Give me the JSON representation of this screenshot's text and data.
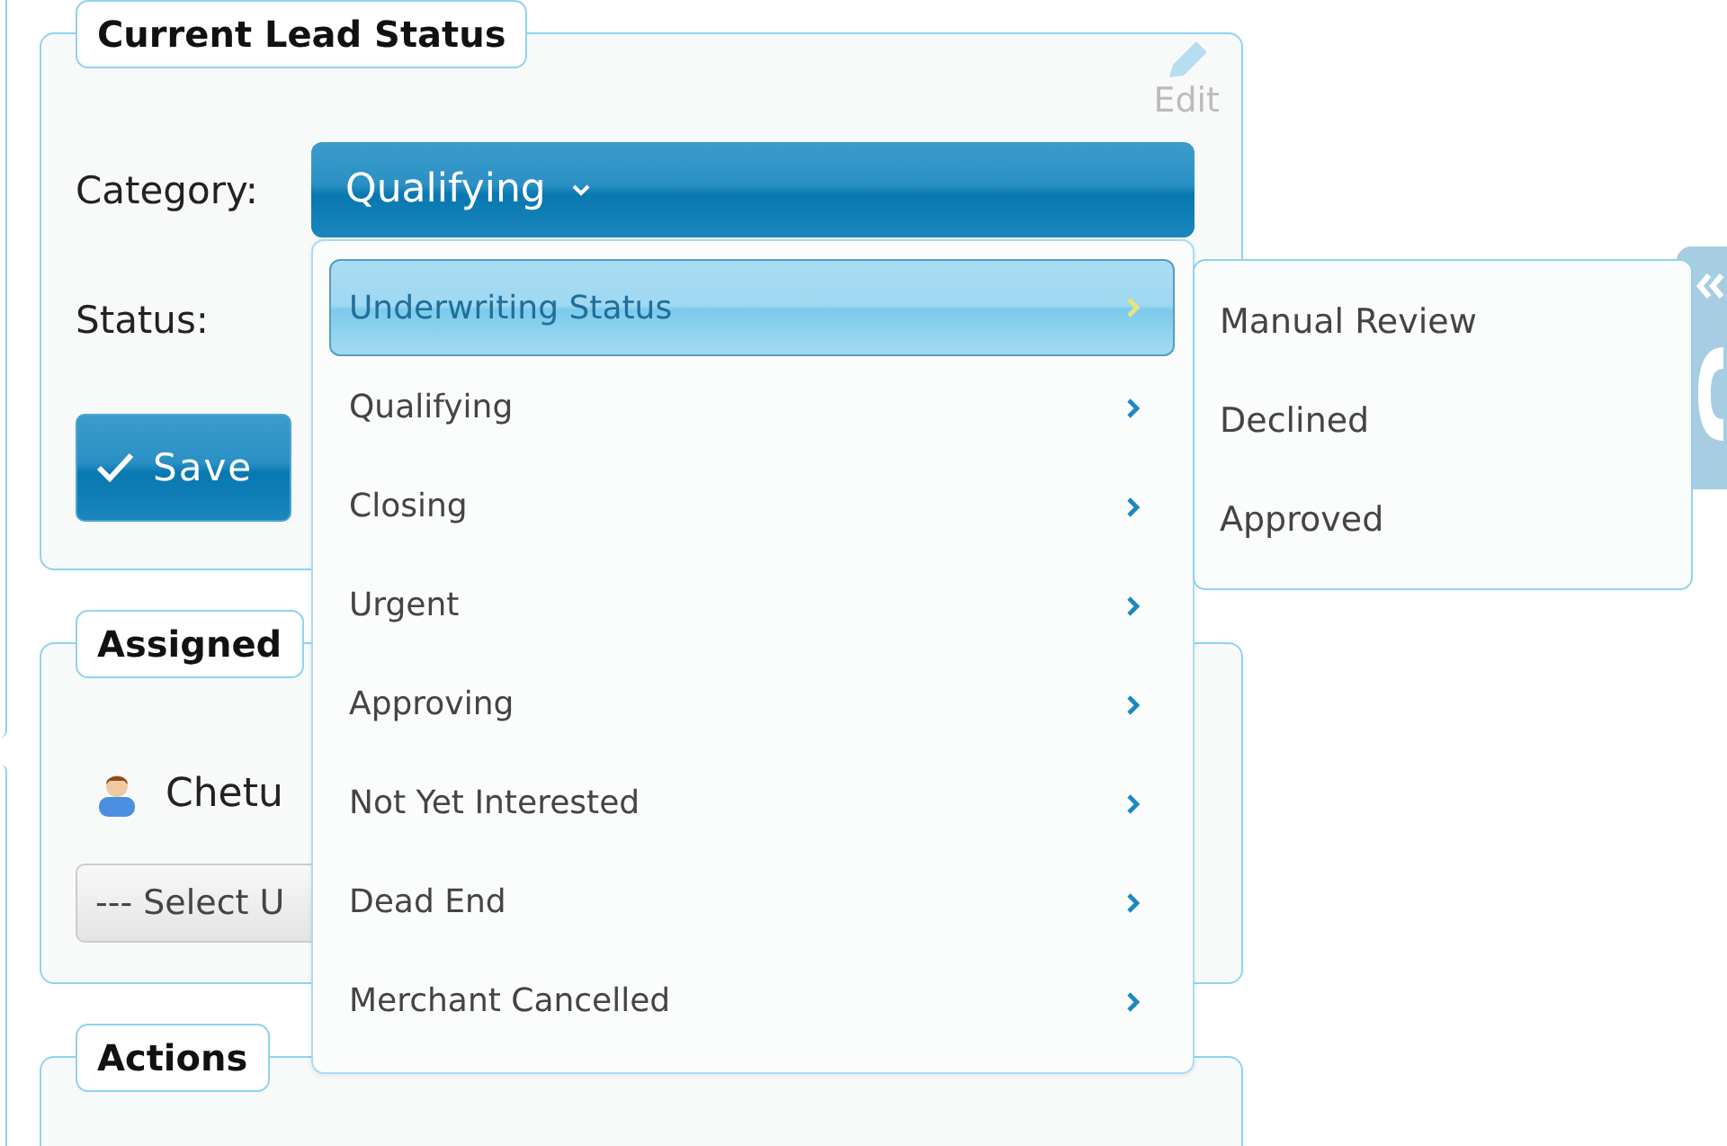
{
  "panels": [
    {
      "kind": "status",
      "title": "Current Lead Status",
      "edit_label": "Edit",
      "fields": [
        {
          "kind": "dropdown",
          "label": "Category:",
          "value": "Qualifying"
        },
        {
          "kind": "text",
          "label": "Status:"
        }
      ],
      "save_label": "Save"
    },
    {
      "kind": "assigned",
      "title": "Assigned",
      "user": "Chetu",
      "select_value": "--- Select U"
    },
    {
      "kind": "actions",
      "title": "Actions"
    }
  ],
  "category_menu": {
    "items": [
      {
        "label": "Underwriting Status",
        "selected": true,
        "children": [
          {
            "label": "Manual Review"
          },
          {
            "label": "Declined"
          },
          {
            "label": "Approved"
          }
        ]
      },
      {
        "label": "Qualifying",
        "selected": false
      },
      {
        "label": "Closing",
        "selected": false
      },
      {
        "label": "Urgent",
        "selected": false
      },
      {
        "label": "Approving",
        "selected": false
      },
      {
        "label": "Not Yet Interested",
        "selected": false
      },
      {
        "label": "Dead End",
        "selected": false
      },
      {
        "label": "Merchant Cancelled",
        "selected": false
      }
    ]
  }
}
